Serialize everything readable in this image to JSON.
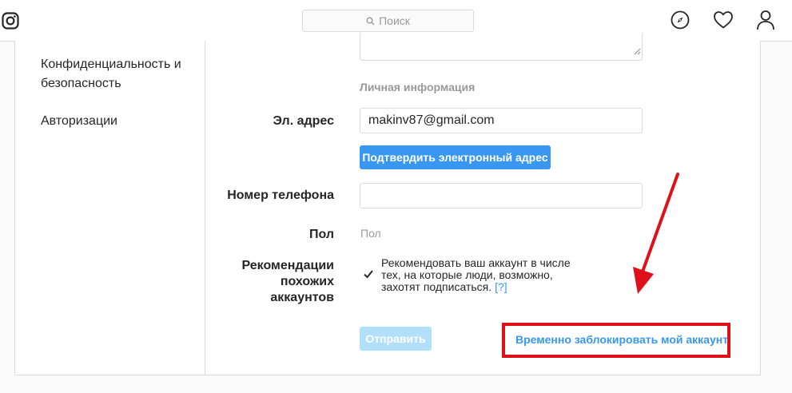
{
  "header": {
    "logo_icon": "instagram-icon",
    "search_placeholder": "Поиск",
    "nav_icons": [
      "explore-compass-icon",
      "heart-icon",
      "profile-icon"
    ]
  },
  "sidebar": {
    "items": [
      {
        "label": "Конфиденциальность и безопасность"
      },
      {
        "label": "Авторизации"
      }
    ]
  },
  "form": {
    "section_title": "Личная информация",
    "email": {
      "label": "Эл. адрес",
      "value": "makinv87@gmail.com"
    },
    "confirm_email_button": "Подтвердить электронный адрес",
    "phone": {
      "label": "Номер телефона",
      "value": ""
    },
    "gender": {
      "label": "Пол",
      "value": "Пол"
    },
    "recommendations": {
      "label": "Рекомендации похожих аккаунтов",
      "checked": true,
      "text": "Рекомендовать ваш аккаунт в числе тех, на которые люди, возможно, захотят подписаться.",
      "help_link": "[?]"
    },
    "submit_button": "Отправить",
    "disable_account_link": "Временно заблокировать мой аккаунт"
  },
  "colors": {
    "accent": "#3897f0",
    "submit_disabled": "#b2dffc",
    "annotation_red": "#e0101b"
  }
}
